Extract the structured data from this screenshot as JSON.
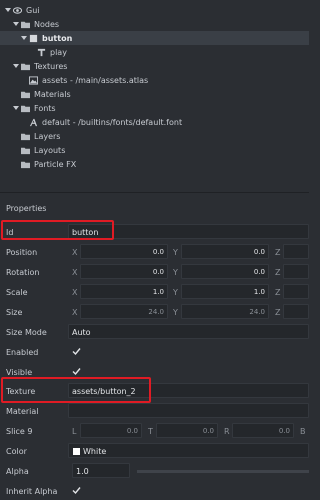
{
  "outline": {
    "items": [
      {
        "label": "Gui",
        "icon": "gui-icon",
        "depth": 0,
        "expanded": true
      },
      {
        "label": "Nodes",
        "icon": "folder-icon",
        "depth": 1,
        "expanded": true
      },
      {
        "label": "button",
        "icon": "box-node-icon",
        "depth": 2,
        "expanded": true,
        "selected": true
      },
      {
        "label": "play",
        "icon": "text-node-icon",
        "depth": 3,
        "expanded": false
      },
      {
        "label": "Textures",
        "icon": "folder-icon",
        "depth": 1,
        "expanded": true
      },
      {
        "label": "assets - /main/assets.atlas",
        "icon": "atlas-icon",
        "depth": 2,
        "expanded": false
      },
      {
        "label": "Materials",
        "icon": "folder-icon",
        "depth": 1,
        "expanded": false
      },
      {
        "label": "Fonts",
        "icon": "folder-icon",
        "depth": 1,
        "expanded": true
      },
      {
        "label": "default - /builtins/fonts/default.font",
        "icon": "font-icon",
        "depth": 2,
        "expanded": false
      },
      {
        "label": "Layers",
        "icon": "folder-icon",
        "depth": 1,
        "expanded": false
      },
      {
        "label": "Layouts",
        "icon": "folder-icon",
        "depth": 1,
        "expanded": false
      },
      {
        "label": "Particle FX",
        "icon": "folder-icon",
        "depth": 1,
        "expanded": false
      }
    ]
  },
  "properties": {
    "title": "Properties",
    "id": {
      "label": "Id",
      "value": "button"
    },
    "position": {
      "label": "Position",
      "x": "0.0",
      "y": "0.0"
    },
    "rotation": {
      "label": "Rotation",
      "x": "0.0",
      "y": "0.0"
    },
    "scale": {
      "label": "Scale",
      "x": "1.0",
      "y": "1.0"
    },
    "size": {
      "label": "Size",
      "x": "24.0",
      "y": "24.0"
    },
    "size_mode": {
      "label": "Size Mode",
      "value": "Auto"
    },
    "enabled": {
      "label": "Enabled",
      "checked": true
    },
    "visible": {
      "label": "Visible",
      "checked": true
    },
    "texture": {
      "label": "Texture",
      "value": "assets/button_2"
    },
    "material": {
      "label": "Material",
      "value": ""
    },
    "slice9": {
      "label": "Slice 9",
      "l": "0.0",
      "t": "0.0",
      "r": "0.0"
    },
    "color": {
      "label": "Color",
      "value": "White",
      "swatch": "#ffffff"
    },
    "alpha": {
      "label": "Alpha",
      "value": "1.0"
    },
    "inherit_alpha": {
      "label": "Inherit Alpha",
      "checked": true
    },
    "axes": {
      "x": "X",
      "y": "Y",
      "z": "Z",
      "l": "L",
      "t": "T",
      "r": "R",
      "b": "B"
    }
  },
  "colors": {
    "highlight": "#e01b24",
    "background": "#2b2e33"
  }
}
